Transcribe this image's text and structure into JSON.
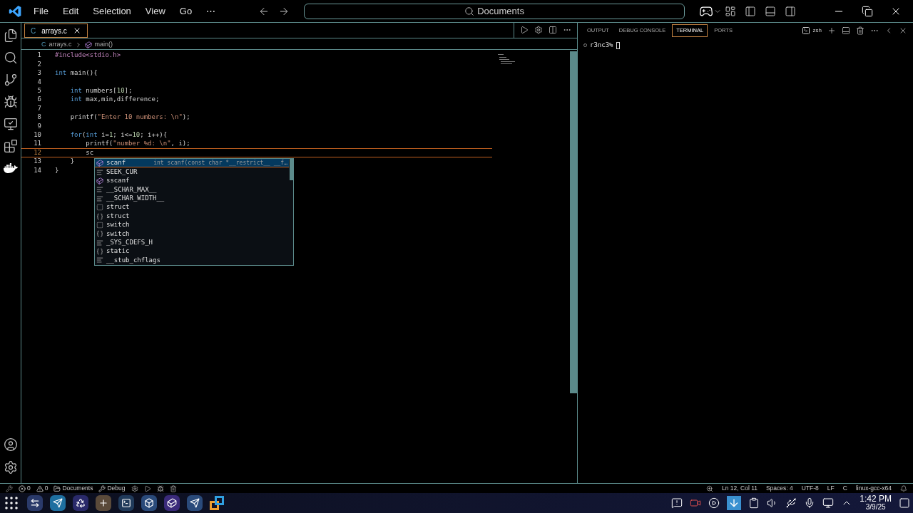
{
  "menu": [
    "File",
    "Edit",
    "Selection",
    "View",
    "Go",
    "⋯"
  ],
  "search": {
    "value": "Documents"
  },
  "editor_tabs": [
    {
      "icon": "C",
      "label": "arrays.c",
      "selected": true
    }
  ],
  "breadcrumb": {
    "file_icon": "C",
    "file": "arrays.c",
    "symbol": "main()"
  },
  "code_lines": [
    {
      "number": "1",
      "current": false,
      "tokens": [
        {
          "kind": "preproc",
          "text": "#include<stdio.h>"
        }
      ]
    },
    {
      "number": "2",
      "current": false
    },
    {
      "number": "3",
      "current": false,
      "tokens": [
        {
          "kind": "keyword",
          "text": "int"
        },
        {
          "kind": "plain",
          "text": " main(){"
        }
      ]
    },
    {
      "number": "4",
      "current": false
    },
    {
      "number": "5",
      "current": false,
      "tokens": [
        {
          "kind": "keyword",
          "text": "    int"
        },
        {
          "kind": "plain",
          "text": " numbers["
        },
        {
          "kind": "number",
          "text": "10"
        },
        {
          "kind": "plain",
          "text": "];"
        }
      ]
    },
    {
      "number": "6",
      "current": false,
      "tokens": [
        {
          "kind": "keyword",
          "text": "    int"
        },
        {
          "kind": "plain",
          "text": " max,min,difference;"
        }
      ]
    },
    {
      "number": "7",
      "current": false
    },
    {
      "number": "8",
      "current": false,
      "tokens": [
        {
          "kind": "plain",
          "text": "    printf("
        },
        {
          "kind": "string",
          "text": "\"Enter 10 numbers: \\n\""
        },
        {
          "kind": "plain",
          "text": ");"
        }
      ]
    },
    {
      "number": "9",
      "current": false
    },
    {
      "number": "10",
      "current": false,
      "tokens": [
        {
          "kind": "keyword",
          "text": "    for"
        },
        {
          "kind": "plain",
          "text": "("
        },
        {
          "kind": "keyword",
          "text": "int"
        },
        {
          "kind": "plain",
          "text": " i="
        },
        {
          "kind": "number",
          "text": "1"
        },
        {
          "kind": "plain",
          "text": "; i<="
        },
        {
          "kind": "number",
          "text": "10"
        },
        {
          "kind": "plain",
          "text": "; i++){"
        }
      ]
    },
    {
      "number": "11",
      "current": false,
      "tokens": [
        {
          "kind": "plain",
          "text": "        printf("
        },
        {
          "kind": "string",
          "text": "\"number %d: \\n\""
        },
        {
          "kind": "plain",
          "text": ", i);"
        }
      ]
    },
    {
      "number": "12",
      "current": true,
      "tokens": [
        {
          "kind": "plain",
          "text": "        sc"
        }
      ]
    },
    {
      "number": "13",
      "current": false,
      "tokens": [
        {
          "kind": "plain",
          "text": "    }"
        }
      ]
    },
    {
      "number": "14",
      "current": false,
      "tokens": [
        {
          "kind": "plain",
          "text": "}"
        }
      ]
    }
  ],
  "suggestions": [
    {
      "label": "scanf",
      "kind": "function",
      "selected": true,
      "detail": "int scanf(const char *__restrict__ __f…"
    },
    {
      "label": "SEEK_CUR",
      "kind": "constant",
      "selected": false
    },
    {
      "label": "sscanf",
      "kind": "function",
      "selected": false
    },
    {
      "label": "__SCHAR_MAX__",
      "kind": "constant",
      "selected": false
    },
    {
      "label": "__SCHAR_WIDTH__",
      "kind": "constant",
      "selected": false
    },
    {
      "label": "struct",
      "kind": "keyword",
      "selected": false
    },
    {
      "label": "struct",
      "kind": "snippet",
      "selected": false
    },
    {
      "label": "switch",
      "kind": "keyword",
      "selected": false
    },
    {
      "label": "switch",
      "kind": "snippet",
      "selected": false
    },
    {
      "label": "_SYS_CDEFS_H",
      "kind": "constant",
      "selected": false
    },
    {
      "label": "static",
      "kind": "snippet",
      "selected": false
    },
    {
      "label": "__stub_chflags",
      "kind": "constant",
      "selected": false
    }
  ],
  "panel_tabs": [
    {
      "label": "OUTPUT",
      "selected": false
    },
    {
      "label": "DEBUG CONSOLE",
      "selected": false
    },
    {
      "label": "TERMINAL",
      "selected": true
    },
    {
      "label": "PORTS",
      "selected": false
    }
  ],
  "terminal": {
    "shell": "zsh",
    "prompt": "r3nc3%"
  },
  "status_bar": {
    "errors": "0",
    "warnings": "0",
    "folder": "Documents",
    "debug": "Debug",
    "position": "Ln 12, Col 11",
    "spaces": "Spaces: 4",
    "encoding": "UTF-8",
    "eol": "LF",
    "language": "C",
    "config": "linux-gcc-x64"
  },
  "taskbar": {
    "time": "1:42 PM",
    "date": "3/9/25"
  }
}
